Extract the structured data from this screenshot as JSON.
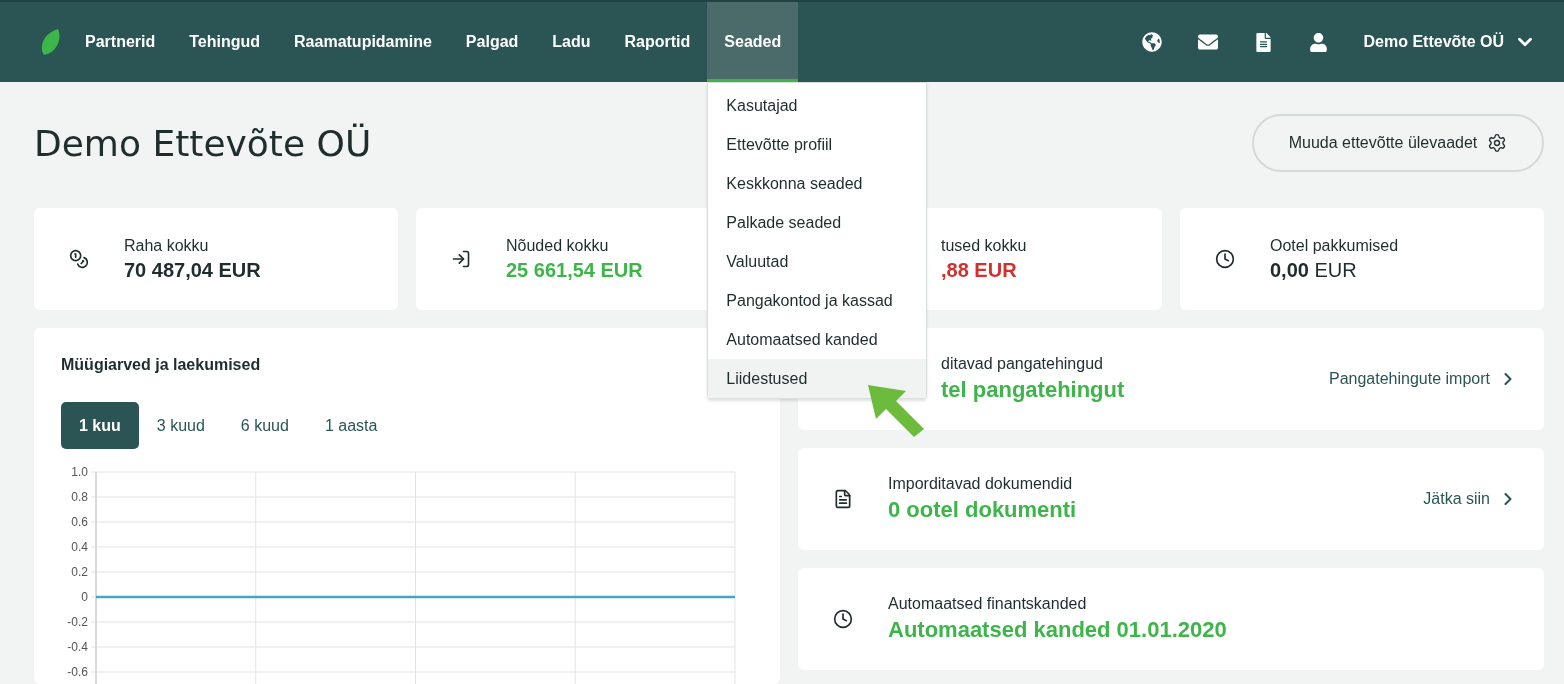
{
  "nav": {
    "items": [
      {
        "label": "Partnerid",
        "selected": false
      },
      {
        "label": "Tehingud",
        "selected": false
      },
      {
        "label": "Raamatupidamine",
        "selected": false
      },
      {
        "label": "Palgad",
        "selected": false
      },
      {
        "label": "Ladu",
        "selected": false
      },
      {
        "label": "Raportid",
        "selected": false
      },
      {
        "label": "Seaded",
        "selected": true
      }
    ],
    "company": "Demo Ettevõte OÜ"
  },
  "menu": {
    "items": [
      {
        "label": "Kasutajad",
        "highlighted": false
      },
      {
        "label": "Ettevõtte profiil",
        "highlighted": false
      },
      {
        "label": "Keskkonna seaded",
        "highlighted": false
      },
      {
        "label": "Palkade seaded",
        "highlighted": false
      },
      {
        "label": "Valuutad",
        "highlighted": false
      },
      {
        "label": "Pangakontod ja kassad",
        "highlighted": false
      },
      {
        "label": "Automaatsed kanded",
        "highlighted": false
      },
      {
        "label": "Liidestused",
        "highlighted": true
      }
    ]
  },
  "page": {
    "title": "Demo Ettevõte OÜ",
    "edit_button": "Muuda ettevõtte ülevaadet"
  },
  "stats": [
    {
      "kind": "coins",
      "label": "Raha kokku",
      "value": "70 487,04 EUR",
      "color": "#1f2d2d",
      "bold": true
    },
    {
      "kind": "incoming",
      "label": "Nõuded kokku",
      "value": "25 661,54 EUR",
      "color": "#3db54a",
      "bold": true
    },
    {
      "kind": "covered",
      "label": "tused kokku",
      "value": ",88 EUR",
      "color": "#d0312d",
      "bold": true
    },
    {
      "kind": "clock",
      "label": "Ootel pakkumised",
      "value": "**0,00** EUR",
      "color": "#1f2d2d",
      "bold": false
    }
  ],
  "chart_panel": {
    "title": "Müügiarved ja laekumised",
    "periods": [
      {
        "label": "1 kuu",
        "selected": true
      },
      {
        "label": "3 kuud",
        "selected": false
      },
      {
        "label": "6 kuud",
        "selected": false
      },
      {
        "label": "1 aasta",
        "selected": false
      }
    ],
    "chart_data": {
      "type": "line",
      "grid": true,
      "ylim": [
        -0.6,
        1.0
      ],
      "yticks": [
        {
          "value": 1.0,
          "label": "1.0"
        },
        {
          "value": 0.8,
          "label": "0.8"
        },
        {
          "value": 0.6,
          "label": "0.6"
        },
        {
          "value": 0.4,
          "label": "0.4"
        },
        {
          "value": 0.2,
          "label": "0.2"
        },
        {
          "value": 0,
          "label": "0"
        },
        {
          "value": -0.2,
          "label": "-0.2"
        },
        {
          "value": -0.4,
          "label": "-0.4"
        },
        {
          "value": -0.6,
          "label": "-0.6"
        }
      ],
      "series": [
        {
          "color": "#4aa3c0",
          "values": [
            0,
            0,
            0,
            0,
            0
          ]
        }
      ]
    }
  },
  "tasks": [
    {
      "kind": "covered",
      "label": "ditavad pangatehingud",
      "value": "tel pangatehingut",
      "link": "Pangatehingute import"
    },
    {
      "kind": "document",
      "label": "Imporditavad dokumendid",
      "value": "0 ootel dokumenti",
      "link": "Jätka siin"
    },
    {
      "kind": "clock",
      "label": "Automaatsed finantskanded",
      "value": "Automaatsed kanded 01.01.2020"
    }
  ]
}
